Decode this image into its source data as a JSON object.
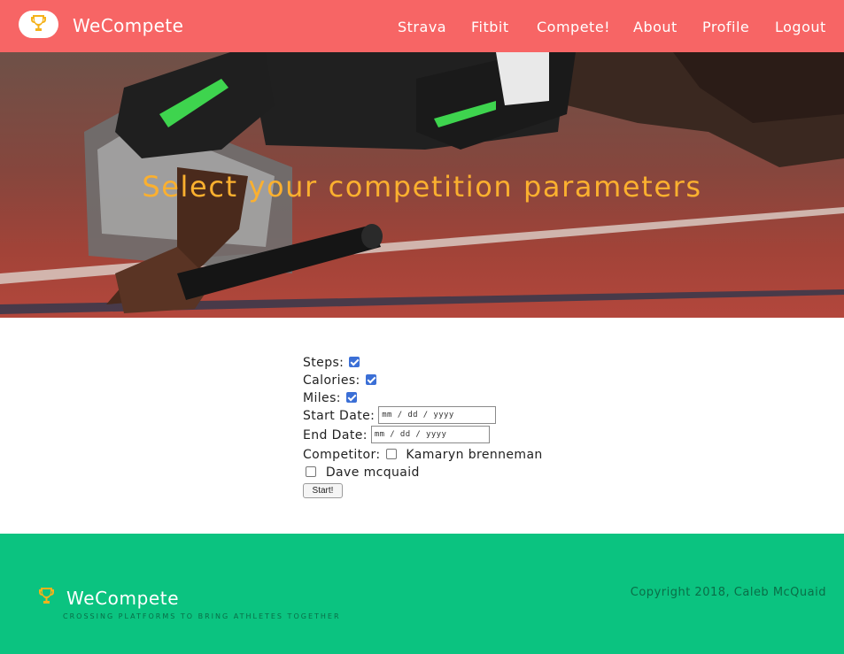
{
  "nav": {
    "brand": "WeCompete",
    "logo_icon": "trophy-icon",
    "links": [
      "Strava",
      "Fitbit",
      "Compete!",
      "About",
      "Profile",
      "Logout"
    ]
  },
  "hero": {
    "title": "Select your competition parameters"
  },
  "form": {
    "steps_label": "Steps:",
    "steps_checked": true,
    "calories_label": "Calories:",
    "calories_checked": true,
    "miles_label": "Miles:",
    "miles_checked": true,
    "start_date_label": "Start Date:",
    "start_date_placeholder": "mm / dd / yyyy",
    "end_date_label": "End Date:",
    "end_date_placeholder": "mm / dd / yyyy",
    "competitor_label": "Competitor:",
    "competitors": [
      {
        "name": "Kamaryn brenneman",
        "checked": false
      },
      {
        "name": "Dave mcquaid",
        "checked": false
      }
    ],
    "start_button": "Start!"
  },
  "footer": {
    "brand": "WeCompete",
    "tagline": "CROSSING PLATFORMS TO BRING ATHLETES TOGETHER",
    "copyright": "Copyright 2018, Caleb McQuaid"
  },
  "colors": {
    "nav_bg": "#f76565",
    "hero_title": "#fbb02f",
    "footer_bg": "#0bc380",
    "footer_muted": "#0a6d47",
    "checkbox": "#3b6fd6"
  }
}
